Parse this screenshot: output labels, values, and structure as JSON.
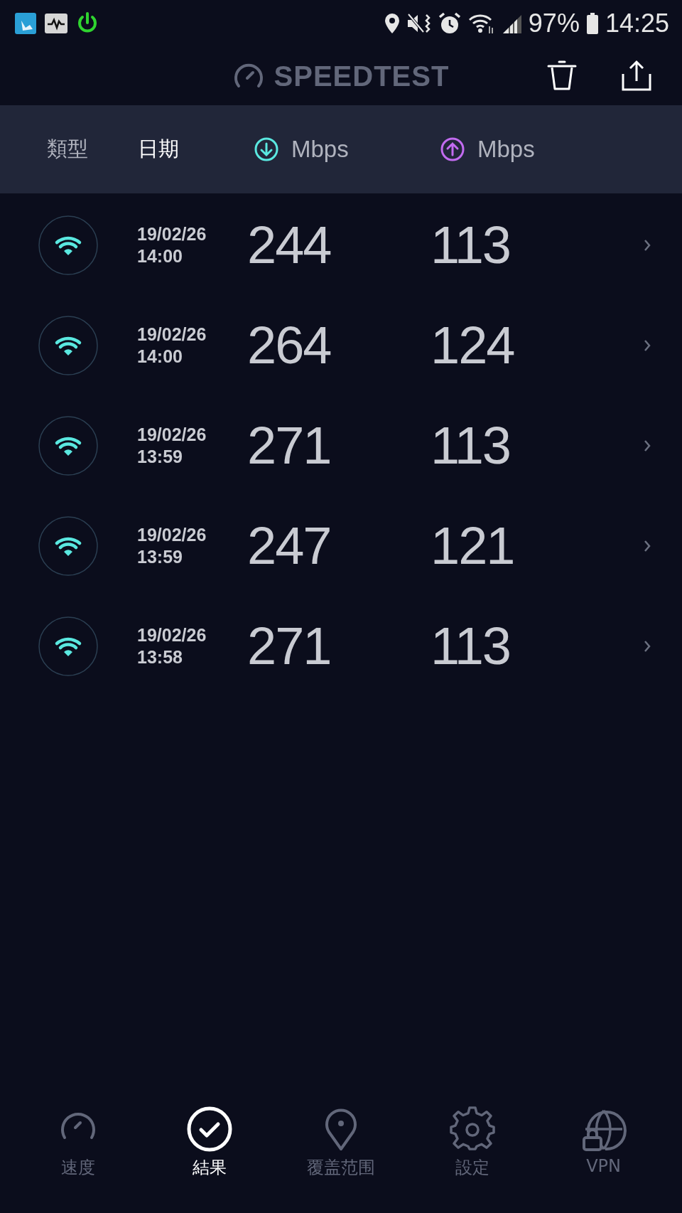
{
  "status_bar": {
    "battery": "97%",
    "time": "14:25"
  },
  "header": {
    "title": "SPEEDTEST"
  },
  "columns": [
    {
      "kind": "type",
      "label": "類型",
      "selected": false
    },
    {
      "kind": "date",
      "label": "日期",
      "selected": true
    },
    {
      "kind": "download",
      "label": "Mbps",
      "selected": false
    },
    {
      "kind": "upload",
      "label": "Mbps",
      "selected": false
    }
  ],
  "results": [
    {
      "date": "19/02/26",
      "time": "14:00",
      "download": "244",
      "upload": "113"
    },
    {
      "date": "19/02/26",
      "time": "14:00",
      "download": "264",
      "upload": "124"
    },
    {
      "date": "19/02/26",
      "time": "13:59",
      "download": "271",
      "upload": "113"
    },
    {
      "date": "19/02/26",
      "time": "13:59",
      "download": "247",
      "upload": "121"
    },
    {
      "date": "19/02/26",
      "time": "13:58",
      "download": "271",
      "upload": "113"
    }
  ],
  "nav": [
    {
      "kind": "speed",
      "label": "速度",
      "selected": false
    },
    {
      "kind": "results",
      "label": "結果",
      "selected": true
    },
    {
      "kind": "coverage",
      "label": "覆盖范围",
      "selected": false
    },
    {
      "kind": "settings",
      "label": "設定",
      "selected": false
    },
    {
      "kind": "vpn",
      "label": "VPN",
      "selected": false
    }
  ]
}
